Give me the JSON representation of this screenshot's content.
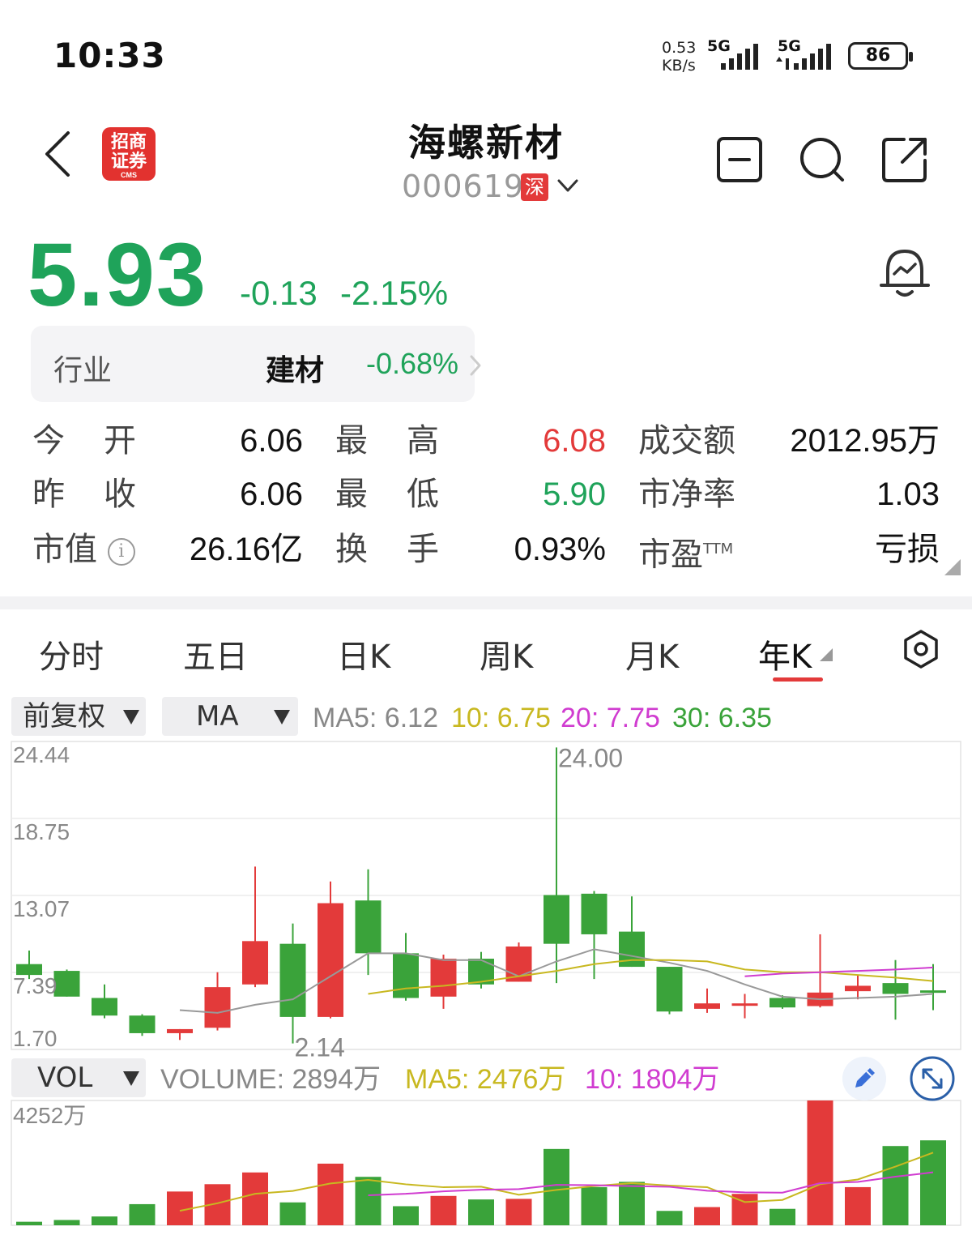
{
  "status_bar": {
    "time": "10:33",
    "net_speed_value": "0.53",
    "net_speed_unit": "KB/s",
    "sim1_label": "5G",
    "sim2_label": "5G",
    "battery": "86"
  },
  "header": {
    "broker_logo_line1": "招商",
    "broker_logo_line2": "证券",
    "broker_logo_sub": "CMS",
    "stock_name": "海螺新材",
    "stock_code": "000619",
    "market_badge": "深"
  },
  "quote": {
    "price": "5.93",
    "change": "-0.13",
    "change_pct": "-2.15%",
    "industry_label": "行业",
    "industry_name": "建材",
    "industry_pct": "-0.68%"
  },
  "stats": {
    "open_label_a": "今",
    "open_label_b": "开",
    "open": "6.06",
    "high_label_a": "最",
    "high_label_b": "高",
    "high": "6.08",
    "turnover_amount_label": "成交额",
    "turnover_amount": "2012.95万",
    "prev_close_label_a": "昨",
    "prev_close_label_b": "收",
    "prev_close": "6.06",
    "low_label_a": "最",
    "low_label_b": "低",
    "low": "5.90",
    "pb_label": "市净率",
    "pb": "1.03",
    "market_cap_label": "市值",
    "market_cap": "26.16亿",
    "turnover_rate_label_a": "换",
    "turnover_rate_label_b": "手",
    "turnover_rate": "0.93%",
    "pe_label": "市盈",
    "pe_sup": "TTM",
    "pe": "亏损",
    "info_glyph": "i"
  },
  "tabs": [
    "分时",
    "五日",
    "日K",
    "周K",
    "月K",
    "年K"
  ],
  "active_tab": "年K",
  "controls": {
    "adjust": "前复权",
    "indicator": "MA",
    "ma5": "MA5: 6.12",
    "ma10": "10: 6.75",
    "ma20": "20: 7.75",
    "ma30": "30: 6.35",
    "vol_indicator": "VOL",
    "volume": "VOLUME: 2894万",
    "vol_ma5": "MA5: 2476万",
    "vol_ma10": "10: 1804万"
  },
  "colors": {
    "up": "#e33a3a",
    "down": "#3aa33a",
    "price_down": "#1fa35a",
    "ma5": "#999999",
    "ma10": "#c8b820",
    "ma20": "#d03cd0",
    "ma30": "#3aa33a"
  },
  "chart_data": {
    "type": "candlestick",
    "period": "year",
    "y_axis_labels": [
      "24.44",
      "18.75",
      "13.07",
      "7.39",
      "1.70"
    ],
    "ylim": [
      1.7,
      24.44
    ],
    "annotations": [
      {
        "label": "24.00",
        "type": "max"
      },
      {
        "label": "2.14",
        "type": "min"
      }
    ],
    "candles": [
      {
        "o": 8.0,
        "h": 9.0,
        "l": 6.9,
        "c": 7.2
      },
      {
        "o": 7.5,
        "h": 7.6,
        "l": 5.6,
        "c": 5.6
      },
      {
        "o": 5.5,
        "h": 6.5,
        "l": 4.0,
        "c": 4.2
      },
      {
        "o": 4.2,
        "h": 4.3,
        "l": 2.7,
        "c": 2.9
      },
      {
        "o": 2.9,
        "h": 3.2,
        "l": 2.4,
        "c": 3.2
      },
      {
        "o": 3.3,
        "h": 7.4,
        "l": 3.1,
        "c": 6.3
      },
      {
        "o": 6.5,
        "h": 15.2,
        "l": 6.3,
        "c": 9.7
      },
      {
        "o": 9.5,
        "h": 11.0,
        "l": 2.14,
        "c": 4.1
      },
      {
        "o": 4.1,
        "h": 14.1,
        "l": 4.0,
        "c": 12.5
      },
      {
        "o": 12.7,
        "h": 15.0,
        "l": 7.2,
        "c": 8.8
      },
      {
        "o": 8.8,
        "h": 10.3,
        "l": 5.3,
        "c": 5.5
      },
      {
        "o": 5.6,
        "h": 8.7,
        "l": 4.7,
        "c": 8.4
      },
      {
        "o": 8.4,
        "h": 8.9,
        "l": 6.2,
        "c": 6.5
      },
      {
        "o": 6.7,
        "h": 9.6,
        "l": 6.7,
        "c": 9.3
      },
      {
        "o": 13.1,
        "h": 24.0,
        "l": 6.6,
        "c": 9.5
      },
      {
        "o": 13.2,
        "h": 13.4,
        "l": 6.9,
        "c": 10.2
      },
      {
        "o": 10.4,
        "h": 13.0,
        "l": 7.8,
        "c": 7.8
      },
      {
        "o": 7.8,
        "h": 7.8,
        "l": 4.3,
        "c": 4.5
      },
      {
        "o": 4.7,
        "h": 6.2,
        "l": 4.4,
        "c": 5.1
      },
      {
        "o": 5.1,
        "h": 5.8,
        "l": 4.0,
        "c": 5.1
      },
      {
        "o": 5.5,
        "h": 5.7,
        "l": 4.7,
        "c": 4.8
      },
      {
        "o": 4.9,
        "h": 10.2,
        "l": 4.8,
        "c": 5.9
      },
      {
        "o": 6.0,
        "h": 7.2,
        "l": 5.4,
        "c": 6.4
      },
      {
        "o": 6.6,
        "h": 8.3,
        "l": 3.9,
        "c": 5.8
      },
      {
        "o": 6.06,
        "h": 8.0,
        "l": 4.6,
        "c": 5.93
      }
    ],
    "ma5": [
      null,
      null,
      null,
      null,
      4.6,
      4.4,
      5.0,
      5.4,
      7.1,
      8.8,
      8.8,
      8.3,
      8.3,
      7.1,
      8.2,
      9.1,
      8.6,
      8.1,
      7.5,
      6.5,
      5.6,
      5.4,
      5.5,
      5.6,
      5.8
    ],
    "ma10": [
      null,
      null,
      null,
      null,
      null,
      null,
      null,
      null,
      null,
      5.8,
      6.2,
      6.4,
      6.7,
      7.1,
      7.5,
      8.0,
      8.3,
      8.3,
      8.2,
      7.6,
      7.4,
      7.4,
      7.2,
      7.0,
      6.75
    ],
    "ma20": [
      null,
      null,
      null,
      null,
      null,
      null,
      null,
      null,
      null,
      null,
      null,
      null,
      null,
      null,
      null,
      null,
      null,
      null,
      null,
      7.1,
      7.3,
      7.4,
      7.5,
      7.6,
      7.75
    ],
    "volume_unit": "万",
    "volume_axis_label": "4252万",
    "volume_max": 4252,
    "volumes": [
      120,
      180,
      300,
      720,
      1150,
      1400,
      1800,
      780,
      2100,
      1650,
      650,
      1000,
      880,
      900,
      2600,
      1300,
      1480,
      490,
      620,
      1070,
      560,
      4252,
      1300,
      2700,
      2894
    ],
    "volume_ma5": [
      null,
      null,
      null,
      null,
      494,
      750,
      1074,
      1170,
      1426,
      1546,
      1396,
      1296,
      1316,
      1040,
      1206,
      1336,
      1436,
      1354,
      1298,
      792,
      864,
      1400,
      1561,
      2000,
      2476
    ],
    "volume_ma10": [
      null,
      null,
      null,
      null,
      null,
      null,
      null,
      null,
      null,
      1020,
      1073,
      1155,
      1213,
      1231,
      1376,
      1366,
      1334,
      1313,
      1178,
      1120,
      1111,
      1436,
      1478,
      1658,
      1804
    ]
  }
}
